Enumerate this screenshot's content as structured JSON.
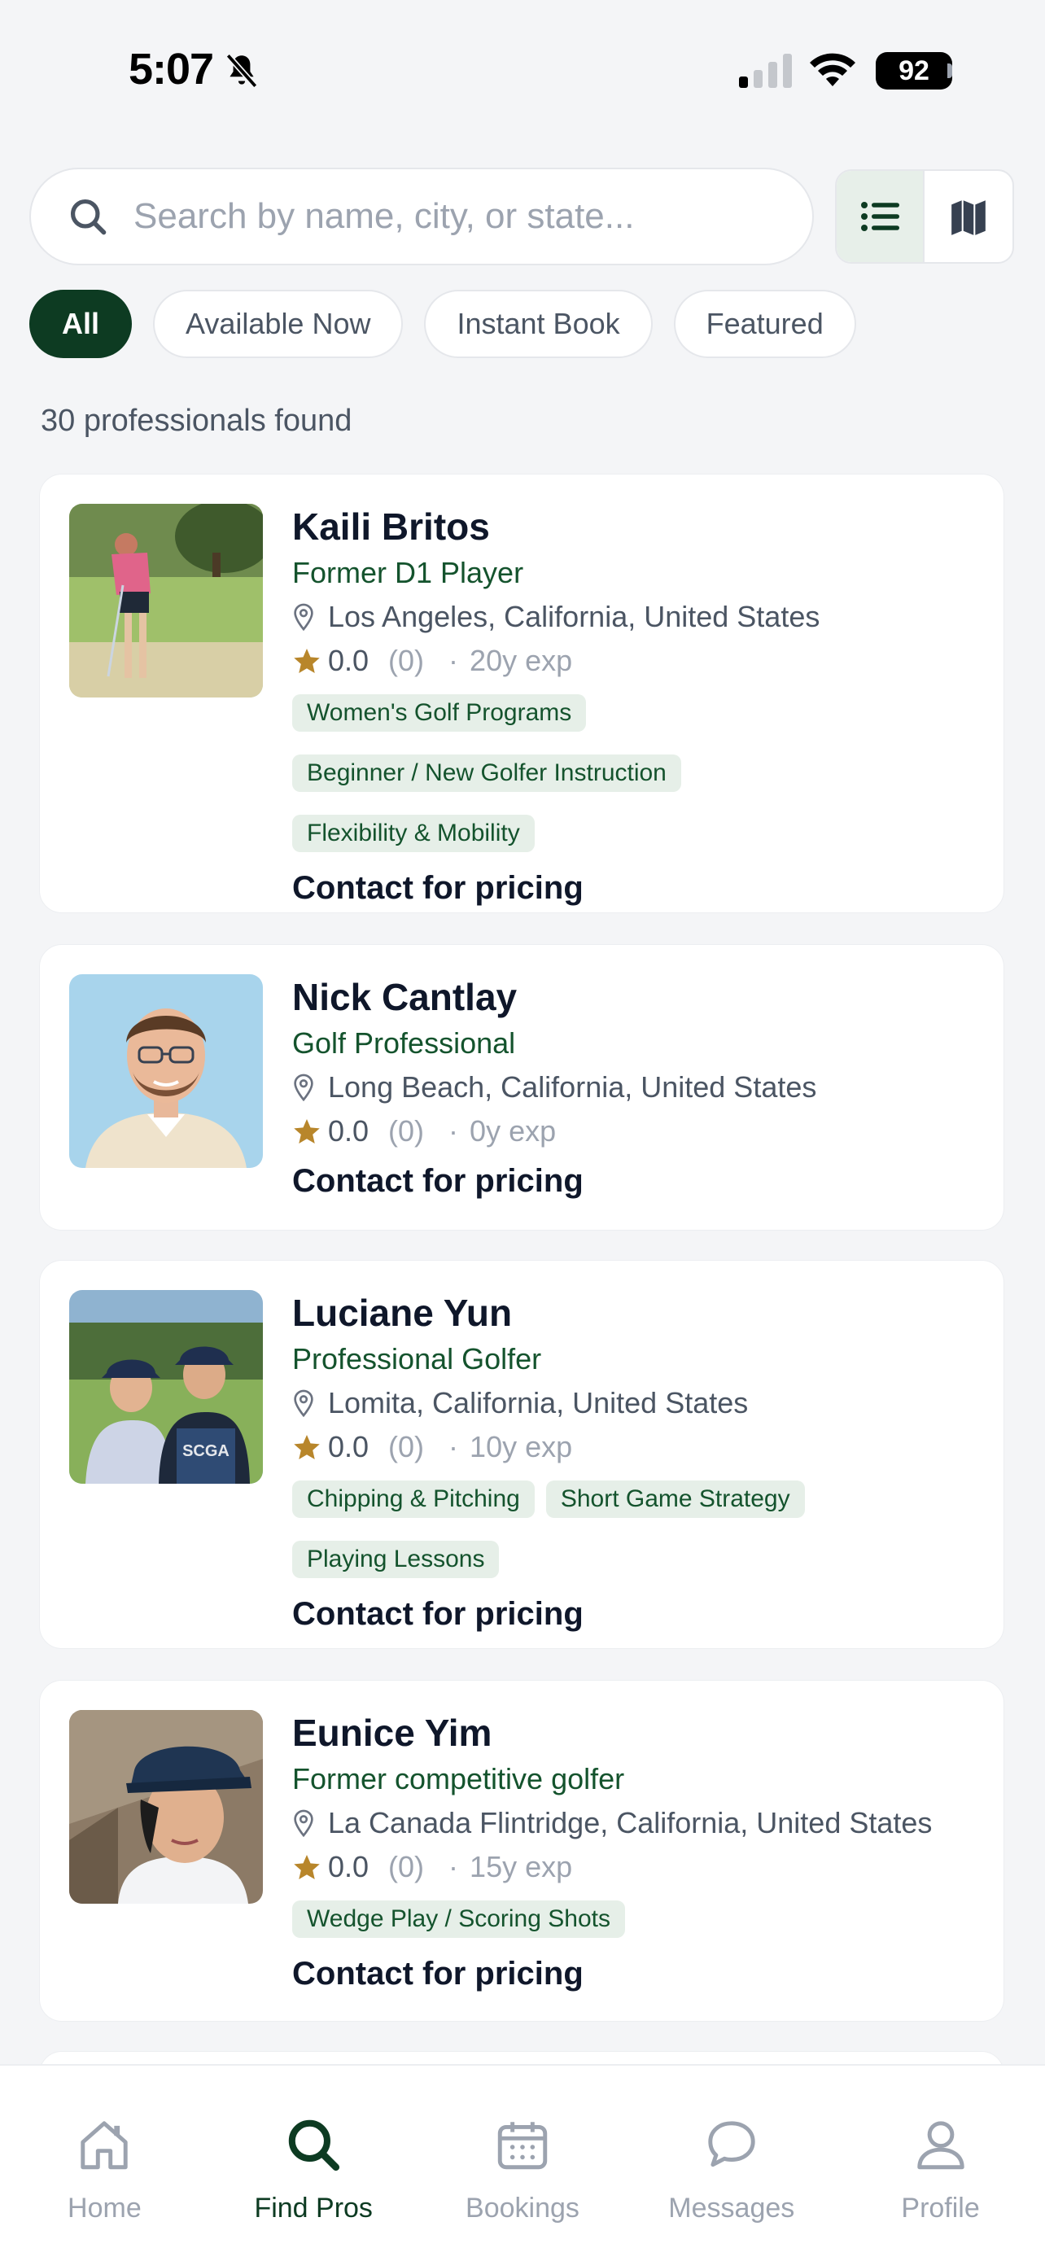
{
  "status": {
    "time": "5:07",
    "battery": "92"
  },
  "search": {
    "placeholder": "Search by name, city, or state..."
  },
  "filters": [
    "All",
    "Available Now",
    "Instant Book",
    "Featured"
  ],
  "results_count": "30 professionals found",
  "pros": [
    {
      "name": "Kaili Britos",
      "title": "Former D1 Player",
      "location": "Los Angeles, California, United States",
      "rating": "0.0",
      "reviews": "(0)",
      "separator": "·",
      "experience": "20y exp",
      "tags": [
        "Women's Golf Programs",
        "Beginner / New Golfer Instruction",
        "Flexibility & Mobility"
      ],
      "pricing": "Contact for pricing"
    },
    {
      "name": "Nick Cantlay",
      "title": "Golf Professional",
      "location": "Long Beach, California, United States",
      "rating": "0.0",
      "reviews": "(0)",
      "separator": "·",
      "experience": "0y exp",
      "tags": [],
      "pricing": "Contact for pricing"
    },
    {
      "name": "Luciane Yun",
      "title": "Professional Golfer",
      "location": "Lomita, California, United States",
      "rating": "0.0",
      "reviews": "(0)",
      "separator": "·",
      "experience": "10y exp",
      "tags": [
        "Chipping & Pitching",
        "Short Game Strategy",
        "Playing Lessons"
      ],
      "pricing": "Contact for pricing"
    },
    {
      "name": "Eunice Yim",
      "title": "Former competitive golfer",
      "location": "La Canada Flintridge, California, United States",
      "rating": "0.0",
      "reviews": "(0)",
      "separator": "·",
      "experience": "15y exp",
      "tags": [
        "Wedge Play / Scoring Shots"
      ],
      "pricing": "Contact for pricing"
    }
  ],
  "photo_caption_3": "SCGA",
  "tabs": [
    {
      "label": "Home",
      "icon": "home-icon"
    },
    {
      "label": "Find Pros",
      "icon": "search-icon"
    },
    {
      "label": "Bookings",
      "icon": "calendar-icon"
    },
    {
      "label": "Messages",
      "icon": "chat-icon"
    },
    {
      "label": "Profile",
      "icon": "user-icon"
    }
  ],
  "colors": {
    "brand": "#0d3b22",
    "tag_bg": "#e6efe8",
    "star": "#b8862b"
  }
}
